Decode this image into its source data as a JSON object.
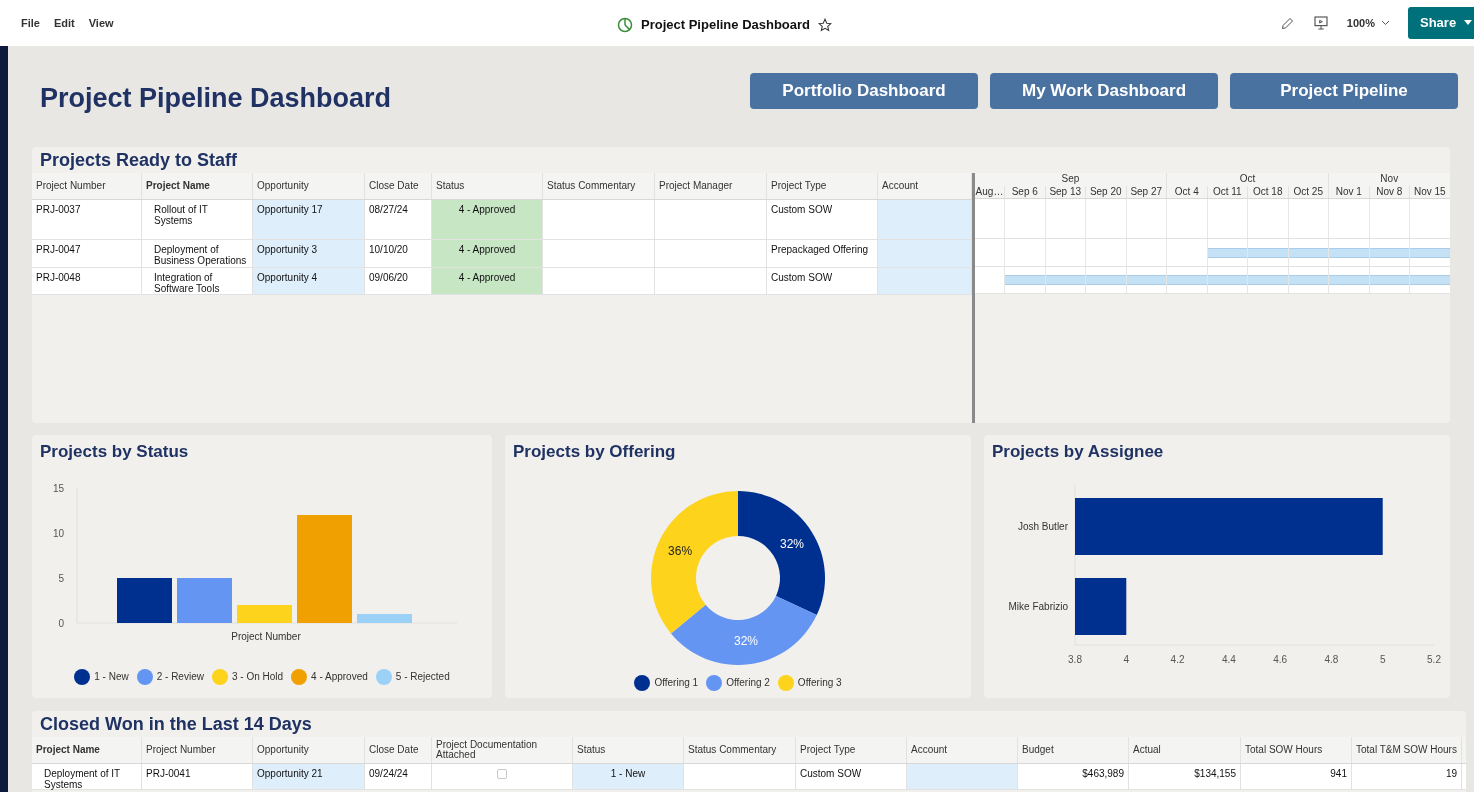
{
  "menu": [
    "File",
    "Edit",
    "View"
  ],
  "document": {
    "title": "Project Pipeline Dashboard",
    "starred": false
  },
  "toolbar": {
    "zoom": "100%",
    "share": "Share"
  },
  "page_title": "Project Pipeline Dashboard",
  "nav_buttons": [
    "Portfolio Dashboard",
    "My Work Dashboard",
    "Project Pipeline"
  ],
  "ready_to_staff": {
    "title": "Projects Ready to Staff",
    "columns": [
      {
        "label": "Project Number",
        "kind": "text"
      },
      {
        "label": "Project Name",
        "kind": "name"
      },
      {
        "label": "Opportunity",
        "kind": "linked"
      },
      {
        "label": "Close Date",
        "kind": "text"
      },
      {
        "label": "Status",
        "kind": "status",
        "color": "#c6e6c4"
      },
      {
        "label": "Status Commentary",
        "kind": "text"
      },
      {
        "label": "Project Manager",
        "kind": "text"
      },
      {
        "label": "Project Type",
        "kind": "text"
      },
      {
        "label": "Account",
        "kind": "linked"
      }
    ],
    "rows": [
      {
        "cells": [
          "PRJ-0037",
          "Rollout of IT Systems",
          "Opportunity 17",
          "08/27/24",
          "4 - Approved",
          "",
          "",
          "Custom SOW",
          ""
        ],
        "timeline": [
          {
            "kind": "empty"
          },
          {
            "kind": "empty"
          },
          {
            "kind": "empty"
          },
          {
            "kind": "empty"
          },
          {
            "kind": "empty"
          },
          {
            "kind": "empty"
          },
          {
            "kind": "empty"
          },
          {
            "kind": "empty"
          },
          {
            "kind": "empty"
          },
          {
            "kind": "empty"
          },
          {
            "kind": "empty"
          },
          {
            "kind": "empty"
          }
        ]
      },
      {
        "cells": [
          "PRJ-0047",
          "Deployment of Business Operations",
          "Opportunity 3",
          "10/10/20",
          "4 - Approved",
          "",
          "",
          "Prepackaged Offering",
          ""
        ],
        "timeline": [
          {
            "kind": "empty"
          },
          {
            "kind": "empty"
          },
          {
            "kind": "empty"
          },
          {
            "kind": "empty"
          },
          {
            "kind": "empty"
          },
          {
            "kind": "empty"
          },
          {
            "kind": "bar"
          },
          {
            "kind": "bar"
          },
          {
            "kind": "bar"
          },
          {
            "kind": "bar"
          },
          {
            "kind": "bar"
          },
          {
            "kind": "bar"
          }
        ]
      },
      {
        "cells": [
          "PRJ-0048",
          "Integration of Software Tools",
          "Opportunity 4",
          "09/06/20",
          "4 - Approved",
          "",
          "",
          "Custom SOW",
          ""
        ],
        "timeline": [
          {
            "kind": "empty"
          },
          {
            "kind": "bar"
          },
          {
            "kind": "bar"
          },
          {
            "kind": "bar"
          },
          {
            "kind": "bar"
          },
          {
            "kind": "bar"
          },
          {
            "kind": "bar"
          },
          {
            "kind": "bar"
          },
          {
            "kind": "bar"
          },
          {
            "kind": "bar"
          },
          {
            "kind": "bar"
          },
          {
            "kind": "bar"
          }
        ]
      }
    ],
    "months": [
      {
        "label": "Sep",
        "weeks": [
          "Aug…",
          "Sep 6",
          "Sep 13",
          "Sep 20",
          "Sep 27"
        ]
      },
      {
        "label": "Oct",
        "weeks": [
          "Oct 4",
          "Oct 11",
          "Oct 18",
          "Oct 25"
        ]
      },
      {
        "label": "Nov",
        "weeks": [
          "Nov 1",
          "Nov 8",
          "Nov 15"
        ]
      }
    ]
  },
  "by_status": {
    "title": "Projects by Status",
    "chart_data": {
      "type": "bar",
      "categories": [
        "Project Number"
      ],
      "ylim": [
        0,
        15
      ],
      "yticks": [
        0,
        5,
        10,
        15
      ],
      "legend": "bottom",
      "series": [
        {
          "name": "1 - New",
          "color": "#00308f",
          "values": [
            5
          ]
        },
        {
          "name": "2 - Review",
          "color": "#6495f2",
          "values": [
            5
          ]
        },
        {
          "name": "3 - On Hold",
          "color": "#fdd31c",
          "values": [
            2
          ]
        },
        {
          "name": "4 - Approved",
          "color": "#f0a000",
          "values": [
            12
          ]
        },
        {
          "name": "5 - Rejected",
          "color": "#9bd1f7",
          "values": [
            1
          ]
        }
      ]
    }
  },
  "by_offering": {
    "title": "Projects by Offering",
    "chart_data": {
      "type": "donut",
      "categories": [
        "Offering 1",
        "Offering 2",
        "Offering 3"
      ],
      "series": [
        {
          "values": [
            32,
            32,
            36
          ]
        }
      ],
      "colors": [
        "#00308f",
        "#6495f2",
        "#fdd31c"
      ],
      "data_labels": "value_labels",
      "value_labels": [
        "32%",
        "32%",
        "36%"
      ],
      "legend": "bottom"
    }
  },
  "by_assignee": {
    "title": "Projects by Assignee",
    "chart_data": {
      "type": "bar",
      "orientation": "horizontal",
      "categories": [
        "Josh Butler",
        "Mike Fabrizio"
      ],
      "series": [
        {
          "color": "#00308f",
          "values": [
            5,
            4
          ]
        }
      ],
      "xlim": [
        3.8,
        5.2
      ],
      "xticks": [
        3.8,
        4,
        4.2,
        4.4,
        4.6,
        4.8,
        5,
        5.2
      ]
    }
  },
  "closed_won": {
    "title": "Closed Won in the Last 14 Days",
    "columns": [
      {
        "label": "Project Name",
        "kind": "name"
      },
      {
        "label": "Project Number",
        "kind": "text"
      },
      {
        "label": "Opportunity",
        "kind": "linked"
      },
      {
        "label": "Close Date",
        "kind": "text"
      },
      {
        "label": "Project Documentation Attached",
        "kind": "check"
      },
      {
        "label": "Status",
        "kind": "status",
        "color": "#dfeefb"
      },
      {
        "label": "Status Commentary",
        "kind": "text"
      },
      {
        "label": "Project Type",
        "kind": "text"
      },
      {
        "label": "Account",
        "kind": "linked"
      },
      {
        "label": "Budget",
        "kind": "number"
      },
      {
        "label": "Actual",
        "kind": "number"
      },
      {
        "label": "Total SOW Hours",
        "kind": "number"
      },
      {
        "label": "Total T&M SOW Hours",
        "kind": "number"
      }
    ],
    "rows": [
      {
        "cells": [
          "Deployment of IT Systems",
          "PRJ-0041",
          "Opportunity 21",
          "09/24/24",
          "",
          "1 - New",
          "",
          "Custom SOW",
          "",
          "$463,989",
          "$134,155",
          "941",
          "19"
        ],
        "documentation_attached": false
      }
    ]
  }
}
